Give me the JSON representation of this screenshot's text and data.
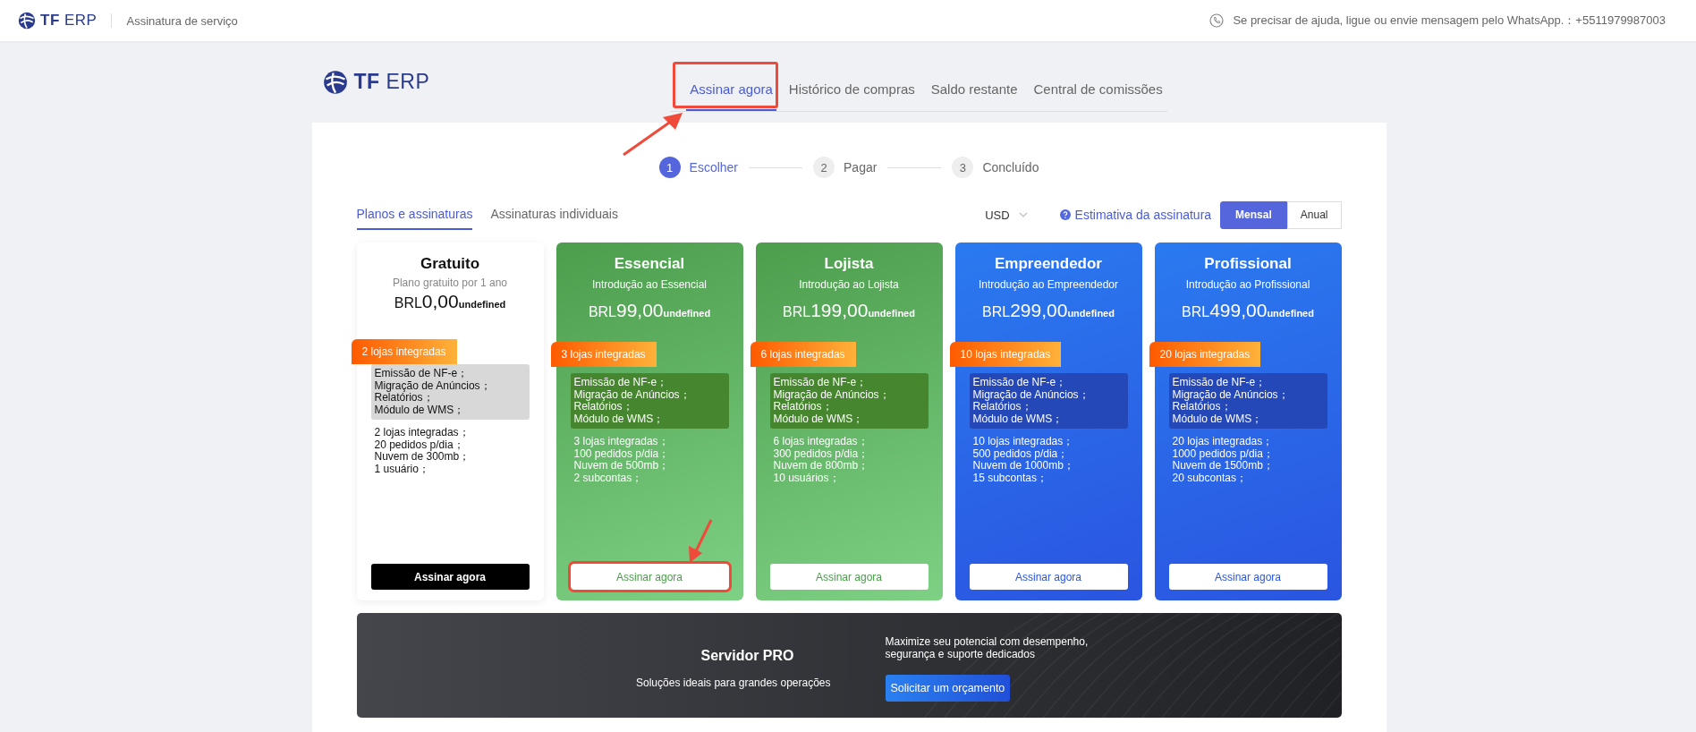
{
  "top_bar": {
    "logo": "**TF** ERP",
    "title": "Assinatura de serviço",
    "help": "Se precisar de ajuda, ligue ou envie mensagem pelo WhatsApp.：+5511979987003"
  },
  "logo": "**TF** ERP",
  "nav_tabs": [
    {
      "label": "Assinar agora",
      "selected": true,
      "annotated": true
    },
    {
      "label": "Histórico de compras",
      "selected": false,
      "annotated": false
    },
    {
      "label": "Saldo restante",
      "selected": false,
      "annotated": false
    },
    {
      "label": "Central de comissões",
      "selected": false,
      "annotated": false
    }
  ],
  "steps": [
    {
      "number": "1",
      "label": "Escolher",
      "selected": true
    },
    {
      "number": "2",
      "label": "Pagar",
      "selected": false
    },
    {
      "number": "3",
      "label": "Concluído",
      "selected": false
    }
  ],
  "plan_tabs": [
    {
      "label": "Planos e assinaturas",
      "selected": true
    },
    {
      "label": "Assinaturas individuais",
      "selected": false
    }
  ],
  "currency": "USD",
  "estimate_link": "Estimativa da assinatura",
  "billing": [
    {
      "label": "Mensal",
      "selected": true
    },
    {
      "label": "Anual",
      "selected": false
    }
  ],
  "plans": [
    {
      "kind": "free",
      "name": "Gratuito",
      "subtitle": "Plano gratuito por 1 ano",
      "currency": "BRL",
      "amount": "0,00",
      "suffix": "undefined",
      "badge": "2 lojas integradas",
      "features": [
        "Emissão de NF-e；",
        "Migração de Anúncios；",
        "Relatórios；",
        "Módulo de WMS；"
      ],
      "limits": [
        "2 lojas integradas；",
        "20 pedidos p/dia；",
        "Nuvem de 300mb；",
        "1 usuário；"
      ],
      "button": "Assinar agora",
      "annotated": false
    },
    {
      "kind": "green",
      "name": "Essencial",
      "subtitle": "Introdução ao Essencial",
      "currency": "BRL",
      "amount": "99,00",
      "suffix": "undefined",
      "badge": "3 lojas integradas",
      "features": [
        "Emissão de NF-e；",
        "Migração de Anúncios；",
        "Relatórios；",
        "Módulo de WMS；"
      ],
      "limits": [
        "3 lojas integradas；",
        "100 pedidos p/dia；",
        "Nuvem de 500mb；",
        "2 subcontas；"
      ],
      "button": "Assinar agora",
      "annotated": true
    },
    {
      "kind": "green",
      "name": "Lojista",
      "subtitle": "Introdução ao Lojista",
      "currency": "BRL",
      "amount": "199,00",
      "suffix": "undefined",
      "badge": "6 lojas integradas",
      "features": [
        "Emissão de NF-e；",
        "Migração de Anúncios；",
        "Relatórios；",
        "Módulo de WMS；"
      ],
      "limits": [
        "6 lojas integradas；",
        "300 pedidos p/dia；",
        "Nuvem de 800mb；",
        "10 usuários；"
      ],
      "button": "Assinar agora",
      "annotated": false
    },
    {
      "kind": "blue",
      "name": "Empreendedor",
      "subtitle": "Introdução ao Empreendedor",
      "currency": "BRL",
      "amount": "299,00",
      "suffix": "undefined",
      "badge": "10 lojas integradas",
      "features": [
        "Emissão de NF-e；",
        "Migração de Anúncios；",
        "Relatórios；",
        "Módulo de WMS；"
      ],
      "limits": [
        "10 lojas integradas；",
        "500 pedidos p/dia；",
        "Nuvem de 1000mb；",
        "15 subcontas；"
      ],
      "button": "Assinar agora",
      "annotated": false
    },
    {
      "kind": "blue",
      "name": "Profissional",
      "subtitle": "Introdução ao Profissional",
      "currency": "BRL",
      "amount": "499,00",
      "suffix": "undefined",
      "badge": "20 lojas integradas",
      "features": [
        "Emissão de NF-e；",
        "Migração de Anúncios；",
        "Relatórios；",
        "Módulo de WMS；"
      ],
      "limits": [
        "20 lojas integradas；",
        "1000 pedidos p/dia；",
        "Nuvem de 1500mb；",
        "20 subcontas；"
      ],
      "button": "Assinar agora",
      "annotated": false
    }
  ],
  "server_banner": {
    "title": "Servidor PRO",
    "subtitle": "Soluções ideais para grandes operações",
    "description": "Maximize seu potencial com desempenho, segurança e suporte dedicados",
    "button": "Solicitar um orçamento"
  }
}
